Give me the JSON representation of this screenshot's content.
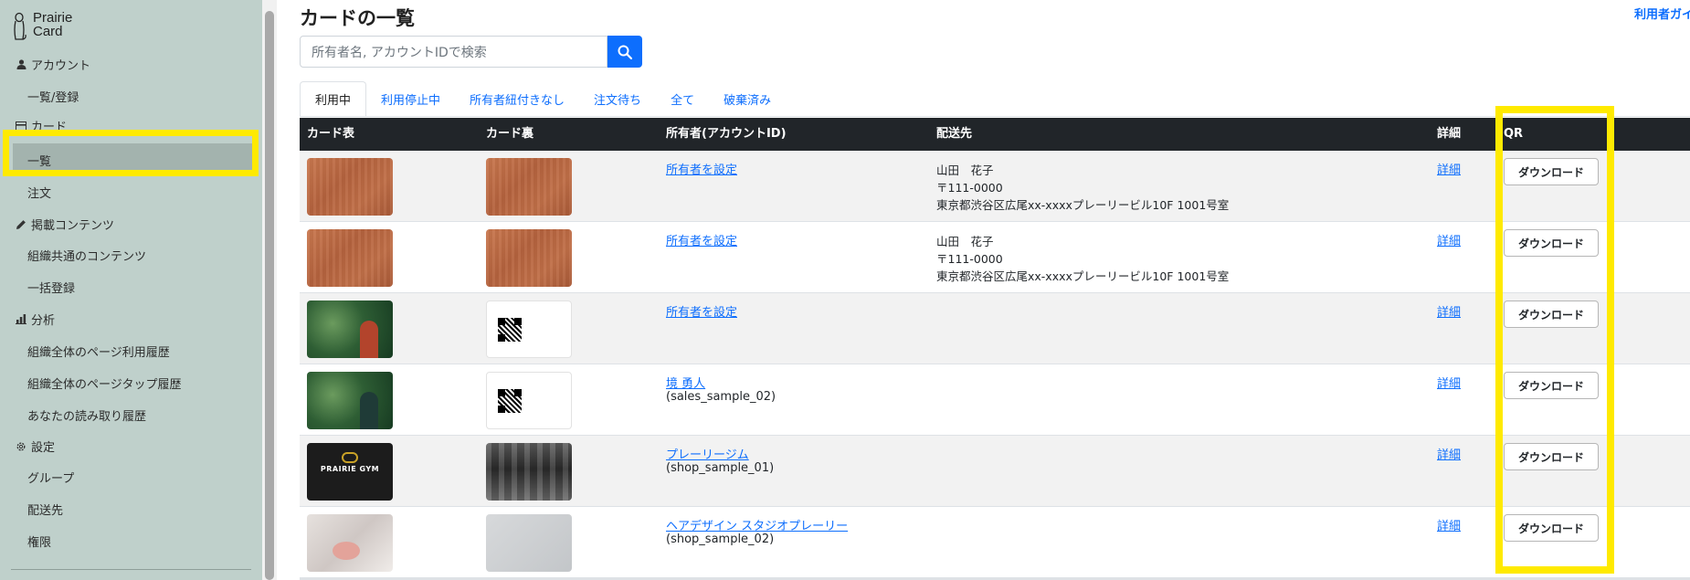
{
  "app": {
    "logo_line1": "Prairie",
    "logo_line2": "Card"
  },
  "sidebar": {
    "sections": [
      {
        "label": "アカウント",
        "icon": "person-icon",
        "items": [
          "一覧/登録"
        ]
      },
      {
        "label": "カード",
        "icon": "card-icon",
        "items": [
          "一覧",
          "注文"
        ]
      },
      {
        "label": "掲載コンテンツ",
        "icon": "pencil-icon",
        "items": [
          "組織共通のコンテンツ",
          "一括登録"
        ]
      },
      {
        "label": "分析",
        "icon": "bar-chart-icon",
        "items": [
          "組織全体のページ利用履歴",
          "組織全体のページタップ履歴",
          "あなたの読み取り履歴"
        ]
      },
      {
        "label": "設定",
        "icon": "gear-icon",
        "items": [
          "グループ",
          "配送先",
          "権限"
        ]
      }
    ]
  },
  "header": {
    "title": "カードの一覧",
    "guide_link": "利用者ガイ"
  },
  "search": {
    "placeholder": "所有者名, アカウントIDで検索"
  },
  "tabs": [
    "利用中",
    "利用停止中",
    "所有者紐付きなし",
    "注文待ち",
    "全て",
    "破棄済み"
  ],
  "table": {
    "headers": {
      "front": "カード表",
      "back": "カード裏",
      "owner": "所有者(アカウントID)",
      "delivery": "配送先",
      "detail": "詳細",
      "qr": "QR"
    },
    "rows": [
      {
        "owner": "所有者を設定",
        "owner_id": "",
        "addr_name": "山田　花子",
        "addr_zip": "〒111-0000",
        "addr_line": "東京都渋谷区広尾xx-xxxxプレーリービル10F 1001号室",
        "detail": "詳細",
        "download": "ダウンロード"
      },
      {
        "owner": "所有者を設定",
        "owner_id": "",
        "addr_name": "山田　花子",
        "addr_zip": "〒111-0000",
        "addr_line": "東京都渋谷区広尾xx-xxxxプレーリービル10F 1001号室",
        "detail": "詳細",
        "download": "ダウンロード"
      },
      {
        "owner": "所有者を設定",
        "owner_id": "",
        "addr_name": "",
        "addr_zip": "",
        "addr_line": "",
        "detail": "詳細",
        "download": "ダウンロード"
      },
      {
        "owner": "境 勇人",
        "owner_id": "(sales_sample_02)",
        "addr_name": "",
        "addr_zip": "",
        "addr_line": "",
        "detail": "詳細",
        "download": "ダウンロード"
      },
      {
        "owner": "プレーリージム",
        "owner_id": "(shop_sample_01)",
        "addr_name": "",
        "addr_zip": "",
        "addr_line": "",
        "detail": "詳細",
        "download": "ダウンロード"
      },
      {
        "owner": "ヘアデザイン スタジオプレーリー",
        "owner_id": "(shop_sample_02)",
        "addr_name": "",
        "addr_zip": "",
        "addr_line": "",
        "detail": "詳細",
        "download": "ダウンロード"
      }
    ]
  },
  "card_art": {
    "gym_logo": "PRAIRIE GYM"
  },
  "colors": {
    "sidebar_bg": "#bfd0cb",
    "accent": "#0d6efd",
    "highlight": "#ffea00",
    "table_header": "#212529"
  }
}
